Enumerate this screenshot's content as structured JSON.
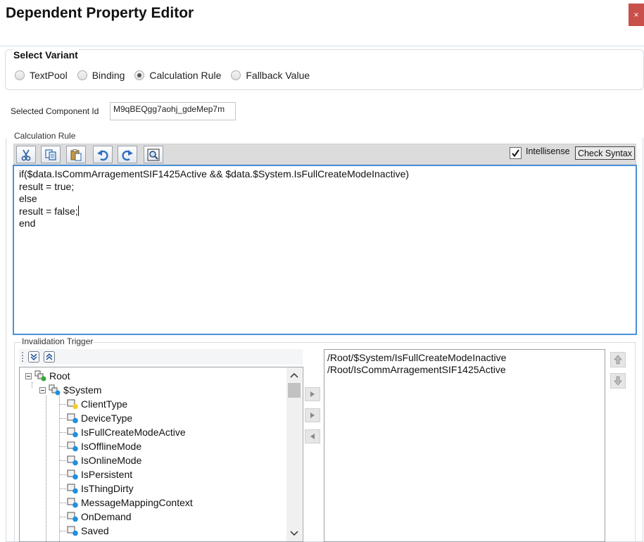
{
  "window": {
    "title": "Dependent Property Editor",
    "close_glyph": "×"
  },
  "variant": {
    "group_title": "Select Variant",
    "options": [
      {
        "label": "TextPool",
        "checked": false
      },
      {
        "label": "Binding",
        "checked": false
      },
      {
        "label": "Calculation Rule",
        "checked": true
      },
      {
        "label": "Fallback Value",
        "checked": false
      }
    ]
  },
  "component": {
    "label": "Selected Component Id",
    "value": "M9qBEQgg7aohj_gdeMep7m"
  },
  "calc": {
    "group_title": "Calculation Rule",
    "toolbar_icons": [
      "cut-icon",
      "copy-icon",
      "paste-icon",
      "undo-icon",
      "redo-icon",
      "find-icon"
    ],
    "intellisense_label": "Intellisense",
    "intellisense_checked": true,
    "check_syntax_label": "Check Syntax",
    "code_lines": [
      "if($data.IsCommArragementSIF1425Active && $data.$System.IsFullCreateModeInactive)",
      "result = true;",
      "else",
      "result = false;",
      "end"
    ]
  },
  "invalidation": {
    "group_title": "Invalidation Trigger",
    "tree": {
      "root_label": "Root",
      "system_label": "$System",
      "children": [
        {
          "label": "ClientType",
          "icon_color": "#f2cf2a"
        },
        {
          "label": "DeviceType",
          "icon_color": "#1e90e0"
        },
        {
          "label": "IsFullCreateModeActive",
          "icon_color": "#1e90e0"
        },
        {
          "label": "IsOfflineMode",
          "icon_color": "#1e90e0"
        },
        {
          "label": "IsOnlineMode",
          "icon_color": "#1e90e0"
        },
        {
          "label": "IsPersistent",
          "icon_color": "#1e90e0"
        },
        {
          "label": "IsThingDirty",
          "icon_color": "#1e90e0"
        },
        {
          "label": "MessageMappingContext",
          "icon_color": "#1e90e0"
        },
        {
          "label": "OnDemand",
          "icon_color": "#1e90e0"
        },
        {
          "label": "Saved",
          "icon_color": "#1e90e0"
        }
      ]
    },
    "selected_paths": [
      "/Root/$System/IsFullCreateModeInactive",
      "/Root/IsCommArragementSIF1425Active"
    ]
  },
  "colors": {
    "accent": "#4a90d9",
    "close": "#c9504a",
    "root_node": "#3aa53a",
    "system_node": "#1e90e0"
  }
}
